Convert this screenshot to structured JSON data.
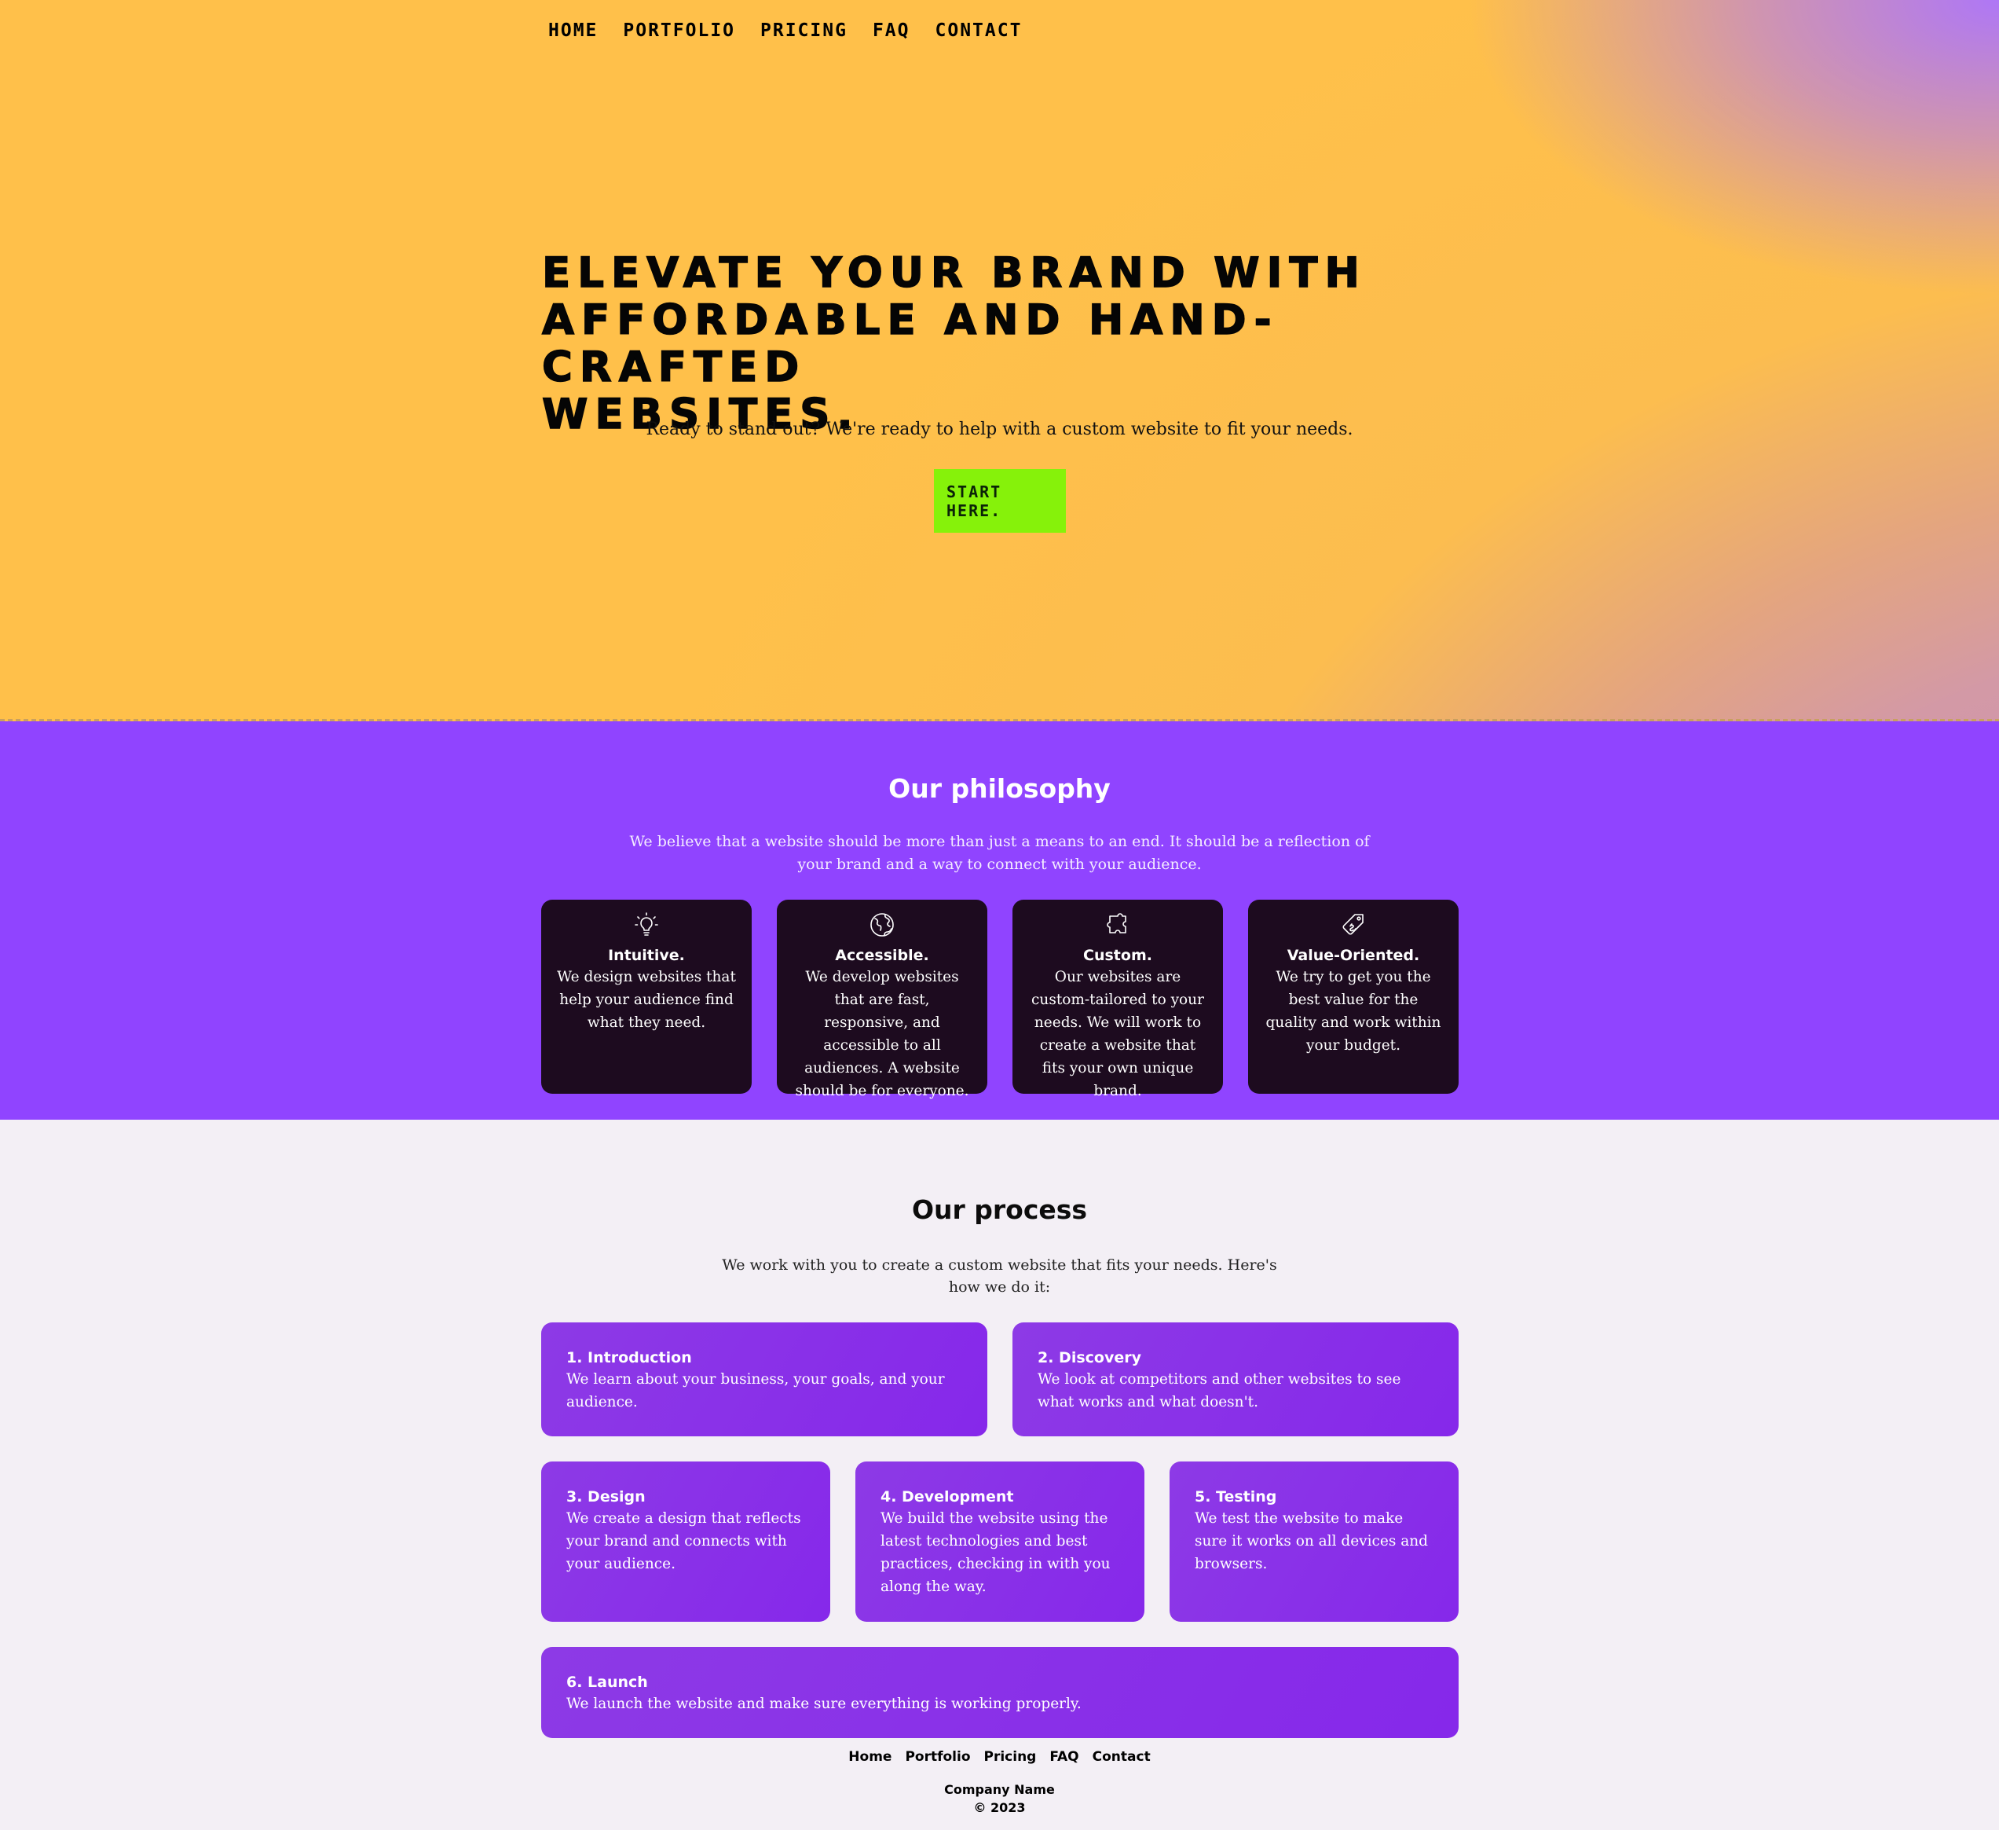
{
  "nav": {
    "items": [
      {
        "label": "HOME"
      },
      {
        "label": "PORTFOLIO"
      },
      {
        "label": "PRICING"
      },
      {
        "label": "FAQ"
      },
      {
        "label": "CONTACT"
      }
    ]
  },
  "hero": {
    "title_lines": [
      "ELEVATE YOUR BRAND WITH",
      "AFFORDABLE AND HAND-CRAFTED",
      "WEBSITES."
    ],
    "subtitle": "Ready to stand out? We're ready to help with a custom website to fit your needs.",
    "cta_line1": "START",
    "cta_line2": "HERE.",
    "cta_color": "#86f20a"
  },
  "philosophy": {
    "title": "Our philosophy",
    "description": "We believe that a website should be more than just a means to an end. It should be a reflection of your brand and a way to connect with your audience.",
    "background": "#9044ff",
    "cards": [
      {
        "icon": "lightbulb-icon",
        "title": "Intuitive.",
        "text": "We design websites that help your audience find what they need."
      },
      {
        "icon": "globe-icon",
        "title": "Accessible.",
        "text": "We develop websites that are fast, responsive, and accessible to all audiences. A website should be for everyone."
      },
      {
        "icon": "puzzle-icon",
        "title": "Custom.",
        "text": "Our websites are custom-tailored to your needs. We will work to create a website that fits your own unique brand."
      },
      {
        "icon": "price-tag-icon",
        "title": "Value-Oriented.",
        "text": "We try to get you the best value for the quality and work within your budget."
      }
    ]
  },
  "process": {
    "title": "Our process",
    "description": "We work with you to create a custom website that fits your needs. Here's how we do it:",
    "steps": [
      {
        "title": "1. Introduction",
        "text": "We learn about your business, your goals, and your audience."
      },
      {
        "title": "2. Discovery",
        "text": "We look at competitors and other websites to see what works and what doesn't."
      },
      {
        "title": "3. Design",
        "text": "We create a design that reflects your brand and connects with your audience."
      },
      {
        "title": "4. Development",
        "text": "We build the website using the latest technologies and best practices, checking in with you along the way."
      },
      {
        "title": "5. Testing",
        "text": "We test the website to make sure it works on all devices and browsers."
      },
      {
        "title": "6. Launch",
        "text": "We launch the website and make sure everything is working properly."
      }
    ]
  },
  "footer": {
    "links": [
      {
        "label": "Home"
      },
      {
        "label": "Portfolio"
      },
      {
        "label": "Pricing"
      },
      {
        "label": "FAQ"
      },
      {
        "label": "Contact"
      }
    ],
    "company": "Company Name",
    "copyright": "© 2023"
  }
}
